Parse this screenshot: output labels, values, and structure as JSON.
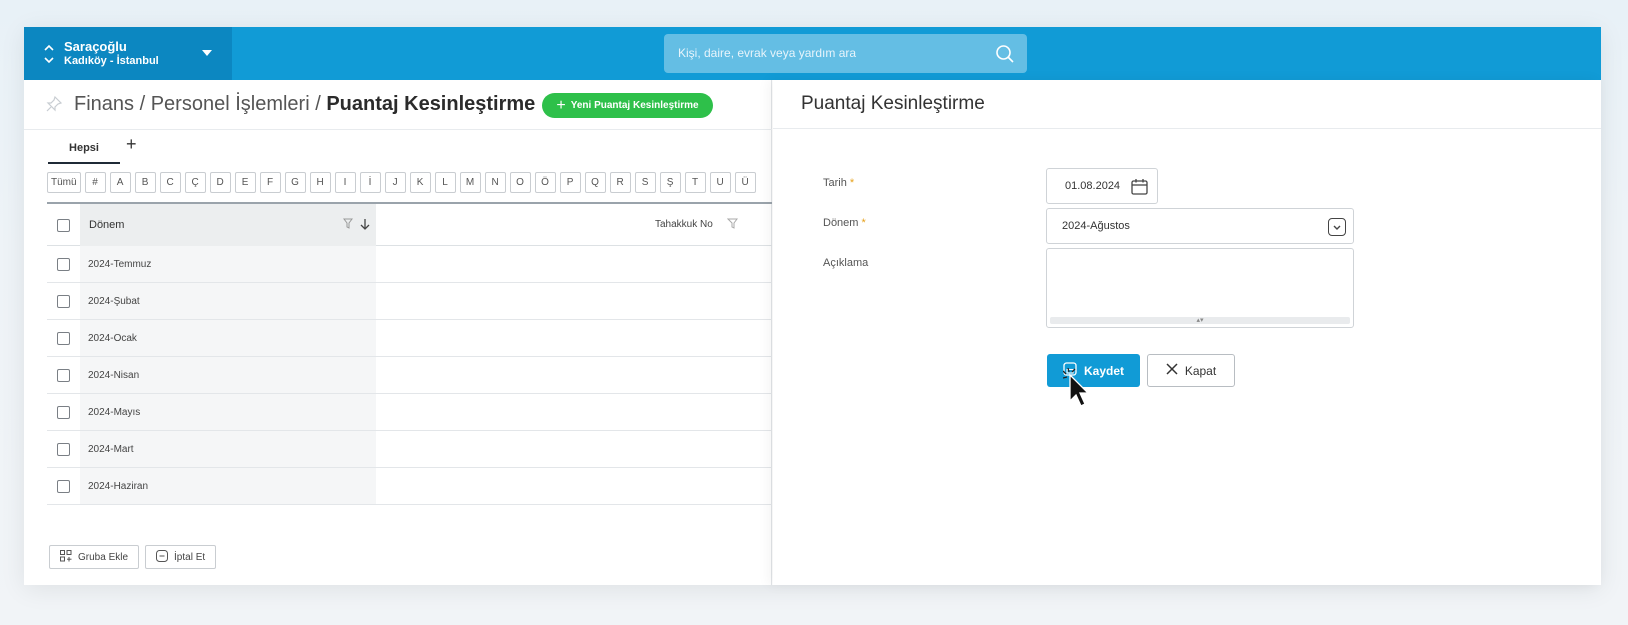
{
  "org": {
    "name": "Saraçoğlu",
    "location": "Kadıköy - İstanbul"
  },
  "search": {
    "placeholder": "Kişi, daire, evrak veya yardım ara"
  },
  "breadcrumb": {
    "part1": "Finans",
    "sep": " / ",
    "part2": "Personel İşlemleri",
    "current": "Puantaj Kesinleştirme"
  },
  "new_button": {
    "label": "Yeni Puantaj Kesinleştirme"
  },
  "tabs": {
    "all": "Hepsi",
    "add": "+"
  },
  "letters": [
    "Tümü",
    "#",
    "A",
    "B",
    "C",
    "Ç",
    "D",
    "E",
    "F",
    "G",
    "H",
    "I",
    "İ",
    "J",
    "K",
    "L",
    "M",
    "N",
    "O",
    "Ö",
    "P",
    "Q",
    "R",
    "S",
    "Ş",
    "T",
    "U",
    "Ü"
  ],
  "grid": {
    "col_donem": "Dönem",
    "col_tahakkuk": "Tahakkuk No",
    "rows": [
      "2024-Temmuz",
      "2024-Şubat",
      "2024-Ocak",
      "2024-Nisan",
      "2024-Mayıs",
      "2024-Mart",
      "2024-Haziran"
    ]
  },
  "footer": {
    "group_add": "Gruba Ekle",
    "cancel": "İptal Et"
  },
  "form": {
    "title": "Puantaj Kesinleştirme",
    "date_label": "Tarih",
    "date_value": "01.08.2024",
    "period_label": "Dönem",
    "period_value": "2024-Ağustos",
    "desc_label": "Açıklama",
    "required_mark": "*",
    "save_label": "Kaydet",
    "close_label": "Kapat"
  },
  "colors": {
    "primary": "#119bd6",
    "green": "#2ec04a"
  }
}
